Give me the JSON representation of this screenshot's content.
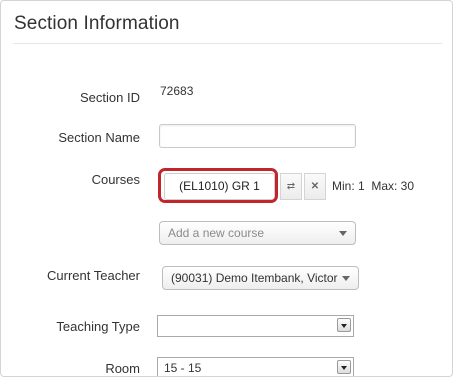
{
  "section": {
    "title": "Section Information",
    "fields": {
      "section_id_label": "Section ID",
      "section_id_value": "72683",
      "section_name_label": "Section Name",
      "section_name_value": "",
      "courses_label": "Courses",
      "course_chip": "(EL1010) GR 1",
      "course_limits": "Min: 1  Max: 30",
      "add_course_placeholder": "Add a new course",
      "current_teacher_label": "Current Teacher",
      "current_teacher_value": "(90031) Demo Itembank, Victor",
      "teaching_type_label": "Teaching Type",
      "teaching_type_value": "",
      "room_label": "Room",
      "room_value": "15 - 15"
    }
  },
  "icons": {
    "swap": "swap-arrows-icon",
    "remove": "close-icon"
  },
  "colors": {
    "highlight": "#c0262b"
  }
}
